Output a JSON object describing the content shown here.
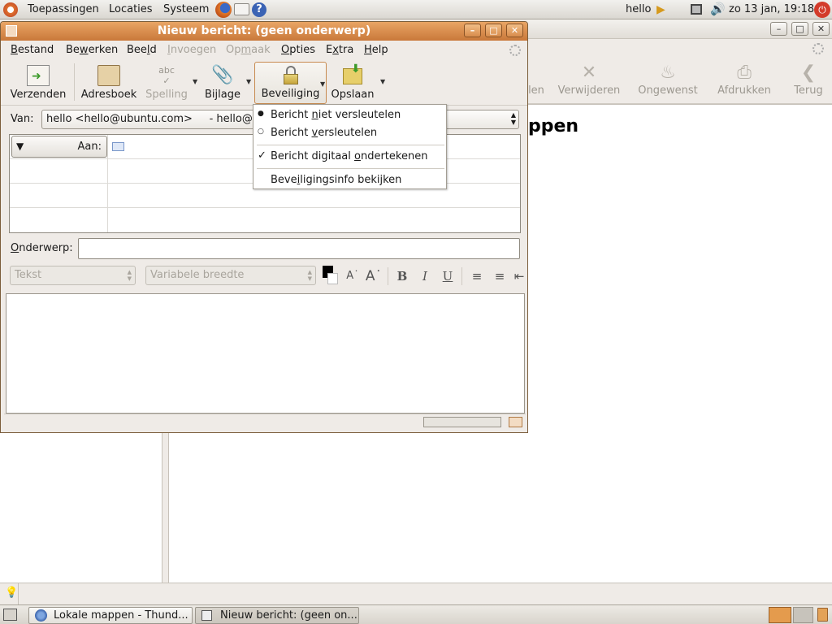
{
  "top_panel": {
    "menus": [
      "Toepassingen",
      "Locaties",
      "Systeem"
    ],
    "user": "hello",
    "datetime": "zo 13 jan, 19:18"
  },
  "bg_window": {
    "toolbar": [
      {
        "label": "Verwijderen",
        "icon": "delete-x-icon"
      },
      {
        "label": "Ongewenst",
        "icon": "junk-flame-icon"
      },
      {
        "label": "Afdrukken",
        "icon": "printer-icon"
      },
      {
        "label": "Terug",
        "icon": "back-arrow-icon"
      }
    ],
    "partial_toolbar_label": "len",
    "heading_partial": "ppen"
  },
  "compose": {
    "title": "Nieuw bericht: (geen onderwerp)",
    "menu": [
      {
        "pre": "",
        "ul": "B",
        "post": "estand",
        "disabled": false
      },
      {
        "pre": "Be",
        "ul": "w",
        "post": "erken",
        "disabled": false
      },
      {
        "pre": "Bee",
        "ul": "l",
        "post": "d",
        "disabled": false
      },
      {
        "pre": "",
        "ul": "I",
        "post": "nvoegen",
        "disabled": true
      },
      {
        "pre": "Op",
        "ul": "m",
        "post": "aak",
        "disabled": true
      },
      {
        "pre": "",
        "ul": "O",
        "post": "pties",
        "disabled": false
      },
      {
        "pre": "E",
        "ul": "x",
        "post": "tra",
        "disabled": false
      },
      {
        "pre": "",
        "ul": "H",
        "post": "elp",
        "disabled": false
      }
    ],
    "toolbar": {
      "send": "Verzenden",
      "addressbook": "Adresboek",
      "spelling": "Spelling",
      "attachment": "Bijlage",
      "security": "Beveiliging",
      "save": "Opslaan"
    },
    "from_label": "Van:",
    "from_value": "hello <hello@ubuntu.com>     - hello@ubuntu.com",
    "to_label": "Aan:",
    "subject_label": "Onderwerp:",
    "subject_value": "",
    "format": {
      "paragraph": "Tekst",
      "font": "Variabele breedte",
      "text_color": "#000000"
    }
  },
  "security_menu": {
    "items": [
      {
        "pre": "Bericht ",
        "ul": "n",
        "post": "iet versleutelen",
        "mark": "radio-selected"
      },
      {
        "pre": "Bericht ",
        "ul": "v",
        "post": "ersleutelen",
        "mark": "radio-empty"
      },
      {
        "pre": "Bericht digitaal ",
        "ul": "o",
        "post": "ndertekenen",
        "mark": "check"
      },
      {
        "pre": "Beve",
        "ul": "i",
        "post": "ligingsinfo bekijken",
        "mark": ""
      }
    ]
  },
  "taskbar": {
    "items": [
      "Lokale mappen - Thund...",
      "Nieuw bericht: (geen on..."
    ]
  },
  "colors": {
    "title_active": "#d68a4a",
    "panel": "#e6e3de",
    "window_bg": "#efebe7"
  }
}
